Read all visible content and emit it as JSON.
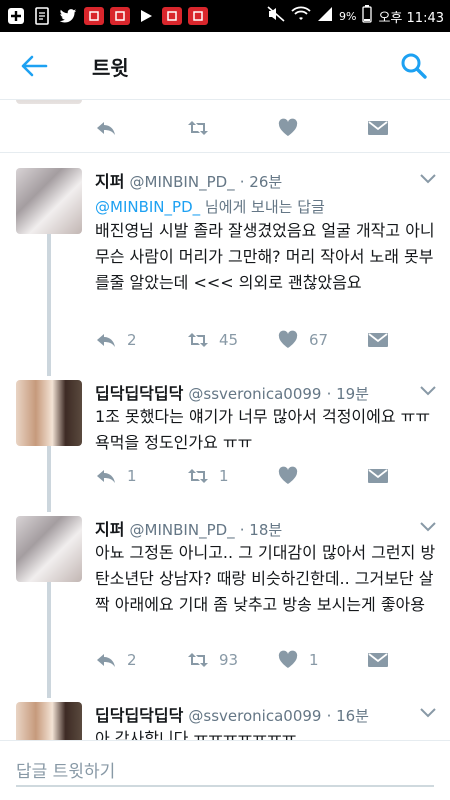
{
  "status_bar": {
    "battery": "9%",
    "time": "오후 11:43"
  },
  "header": {
    "title": "트윗"
  },
  "tweets": [
    {
      "name": "지퍼",
      "handle": "@MINBIN_PD_",
      "time": "· 26분",
      "reply_to_handle": "@MINBIN_PD_",
      "reply_to_suffix": " 님에게 보내는 답글",
      "text": "배진영님 시발 졸라 잘생겼었음요 얼굴 개작고 아니 무슨 사람이 머리가 그만해? 머리 작아서 노래 못부를줄 알았는데 <<< 의외로 괜찮았음요",
      "replies": "2",
      "retweets": "45",
      "likes": "67"
    },
    {
      "name": "딥닥딥닥딥닥",
      "handle": "@ssveronica0099",
      "time": "· 19분",
      "text": "1조 못했다는 얘기가 너무 많아서 걱정이에요 ㅠㅠ 욕먹을 정도인가요 ㅠㅠ",
      "replies": "1",
      "retweets": "1",
      "likes": ""
    },
    {
      "name": "지퍼",
      "handle": "@MINBIN_PD_",
      "time": "· 18분",
      "text": "아뇨 그정돈 아니고.. 그 기대감이 많아서 그런지 방탄소년단 상남자? 때랑 비슷하긴한데.. 그거보단 살짝 아래에요 기대 좀 낮추고 방송 보시는게 좋아용",
      "replies": "2",
      "retweets": "93",
      "likes": "1"
    },
    {
      "name": "딥닥딥닥딥닥",
      "handle": "@ssveronica0099",
      "time": "· 16분",
      "text": "아 감사합니다 ㅠㅠㅠㅠㅠㅠㅠ"
    }
  ],
  "compose": {
    "placeholder": "답글 트윗하기"
  },
  "colors": {
    "accent": "#1da1f2",
    "action_gray": "#8899a6",
    "notification_red": "#d9262c"
  }
}
